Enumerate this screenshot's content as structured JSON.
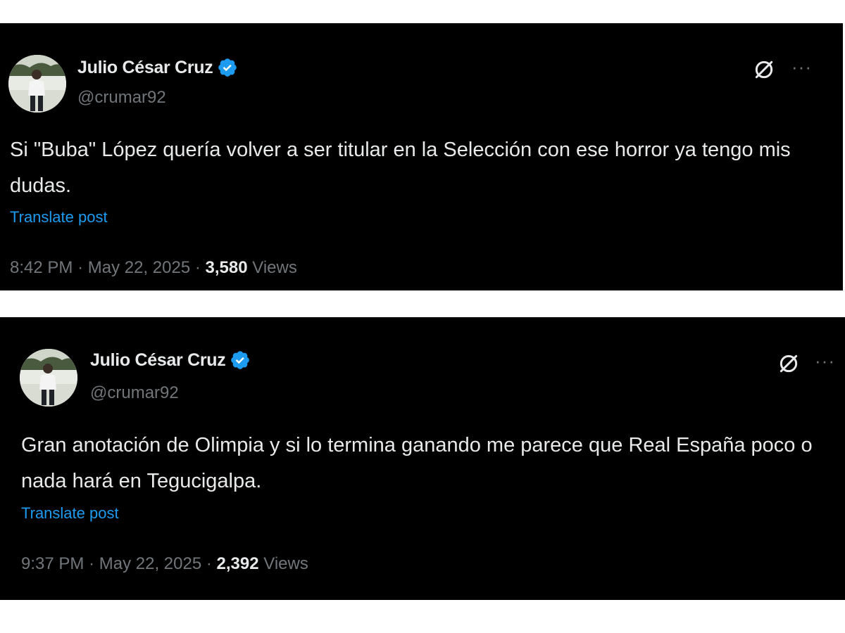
{
  "colors": {
    "background": "#000000",
    "text_primary": "#e7e9ea",
    "text_secondary": "#71767b",
    "link": "#1d9bf0",
    "verified_badge": "#1d9bf0"
  },
  "tweets": [
    {
      "author": {
        "display_name": "Julio César Cruz",
        "handle": "@crumar92",
        "verified_icon": "verified-badge-icon"
      },
      "text": "Si \"Buba\" López quería volver a ser titular en la Selección con ese horror ya tengo mis dudas.",
      "translate_label": "Translate post",
      "time": "8:42 PM",
      "date": "May 22, 2025",
      "separator": "·",
      "views_count": "3,580",
      "views_label": "Views",
      "grok_icon": "grok-icon",
      "more_icon": "more-options-icon",
      "more_glyph": "···"
    },
    {
      "author": {
        "display_name": "Julio César Cruz",
        "handle": "@crumar92",
        "verified_icon": "verified-badge-icon"
      },
      "text": "Gran anotación de Olimpia y si lo termina ganando me parece que Real España poco o nada hará en Tegucigalpa.",
      "translate_label": "Translate post",
      "time": "9:37 PM",
      "date": "May 22, 2025",
      "separator": "·",
      "views_count": "2,392",
      "views_label": "Views",
      "grok_icon": "grok-icon",
      "more_icon": "more-options-icon",
      "more_glyph": "···"
    }
  ]
}
